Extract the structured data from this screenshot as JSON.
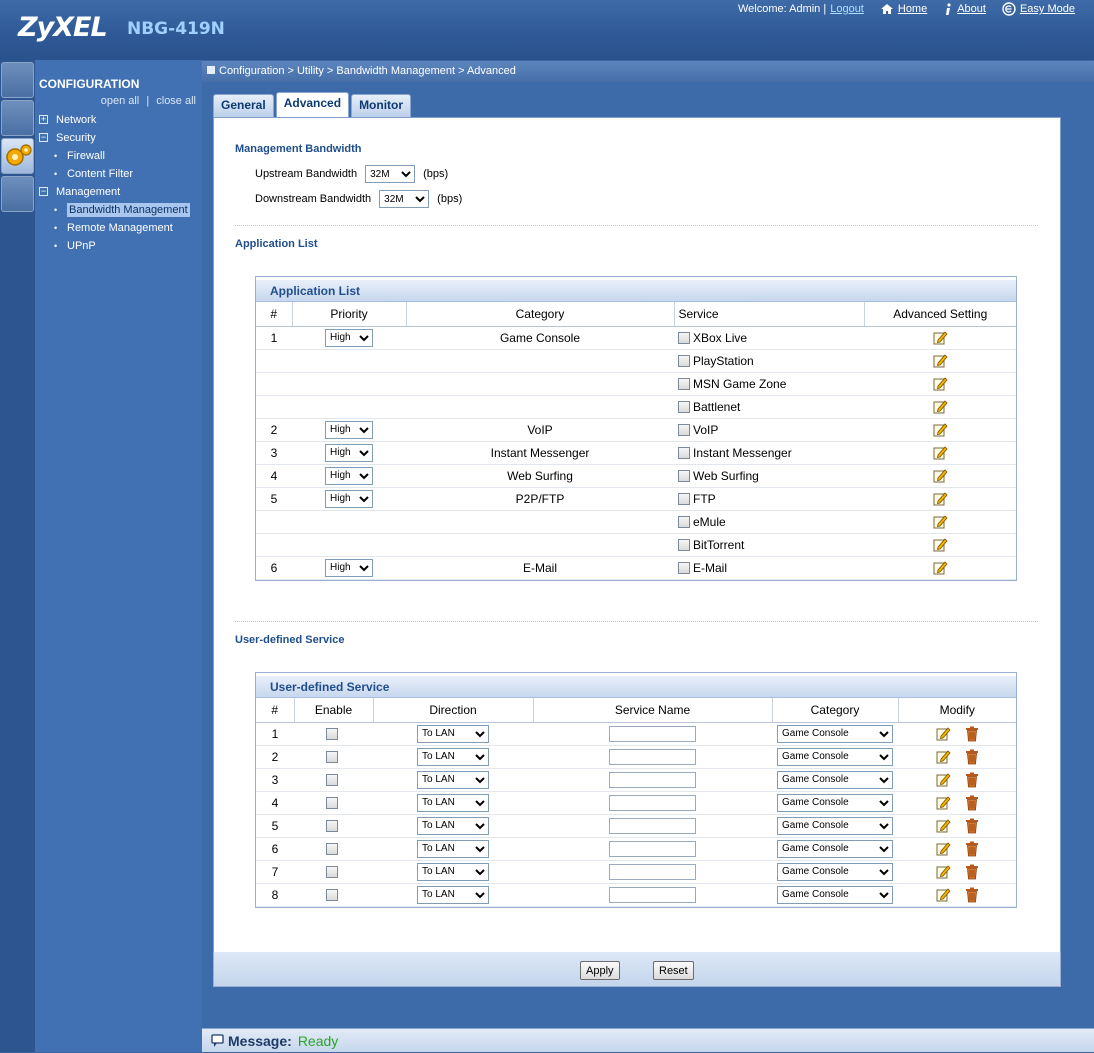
{
  "header": {
    "brand": "ZyXEL",
    "model": "NBG-419N",
    "welcome": "Welcome: Admin |",
    "logout": "Logout",
    "home": "Home",
    "about": "About",
    "easy_mode": "Easy Mode"
  },
  "sidebar": {
    "title": "CONFIGURATION",
    "open_all": "open all",
    "separator": "|",
    "close_all": "close all",
    "items": [
      {
        "label": "Network",
        "level": "top"
      },
      {
        "label": "Security",
        "level": "top"
      },
      {
        "label": "Firewall",
        "level": "sub"
      },
      {
        "label": "Content Filter",
        "level": "sub"
      },
      {
        "label": "Management",
        "level": "top"
      },
      {
        "label": "Bandwidth Management",
        "level": "sub",
        "selected": true
      },
      {
        "label": "Remote Management",
        "level": "sub"
      },
      {
        "label": "UPnP",
        "level": "sub"
      }
    ]
  },
  "breadcrumb": "Configuration > Utility > Bandwidth Management > Advanced",
  "tabs": [
    "General",
    "Advanced",
    "Monitor"
  ],
  "mgmt": {
    "title": "Management Bandwidth",
    "upstream_label": "Upstream Bandwidth",
    "upstream_value": "32M",
    "downstream_label": "Downstream Bandwidth",
    "downstream_value": "32M",
    "unit": "(bps)"
  },
  "app_list": {
    "section_title": "Application List",
    "table_title": "Application List",
    "headers": [
      "#",
      "Priority",
      "Category",
      "Service",
      "Advanced Setting"
    ],
    "rows": [
      {
        "num": "1",
        "priority": "High",
        "category": "Game Console",
        "service": "XBox Live"
      },
      {
        "num": "",
        "priority": "",
        "category": "",
        "service": "PlayStation"
      },
      {
        "num": "",
        "priority": "",
        "category": "",
        "service": "MSN Game Zone"
      },
      {
        "num": "",
        "priority": "",
        "category": "",
        "service": "Battlenet"
      },
      {
        "num": "2",
        "priority": "High",
        "category": "VoIP",
        "service": "VoIP"
      },
      {
        "num": "3",
        "priority": "High",
        "category": "Instant Messenger",
        "service": "Instant Messenger"
      },
      {
        "num": "4",
        "priority": "High",
        "category": "Web Surfing",
        "service": "Web Surfing"
      },
      {
        "num": "5",
        "priority": "High",
        "category": "P2P/FTP",
        "service": "FTP"
      },
      {
        "num": "",
        "priority": "",
        "category": "",
        "service": "eMule"
      },
      {
        "num": "",
        "priority": "",
        "category": "",
        "service": "BitTorrent"
      },
      {
        "num": "6",
        "priority": "High",
        "category": "E-Mail",
        "service": "E-Mail"
      }
    ]
  },
  "user_service": {
    "section_title": "User-defined Service",
    "table_title": "User-defined Service",
    "headers": [
      "#",
      "Enable",
      "Direction",
      "Service Name",
      "Category",
      "Modify"
    ],
    "rows": [
      {
        "num": "1",
        "direction": "To LAN",
        "category": "Game Console"
      },
      {
        "num": "2",
        "direction": "To LAN",
        "category": "Game Console"
      },
      {
        "num": "3",
        "direction": "To LAN",
        "category": "Game Console"
      },
      {
        "num": "4",
        "direction": "To LAN",
        "category": "Game Console"
      },
      {
        "num": "5",
        "direction": "To LAN",
        "category": "Game Console"
      },
      {
        "num": "6",
        "direction": "To LAN",
        "category": "Game Console"
      },
      {
        "num": "7",
        "direction": "To LAN",
        "category": "Game Console"
      },
      {
        "num": "8",
        "direction": "To LAN",
        "category": "Game Console"
      }
    ]
  },
  "buttons": {
    "apply": "Apply",
    "reset": "Reset"
  },
  "status": {
    "label": "Message:",
    "value": "Ready"
  },
  "icons": {
    "home": "home-icon",
    "about": "info-icon",
    "easy_mode": "easy-mode-icon",
    "edit": "edit-icon",
    "delete": "trash-icon",
    "message": "message-icon"
  },
  "colors": {
    "accent": "#204f8d",
    "status_ready": "#28a428",
    "sidebar": "#4171b2"
  }
}
